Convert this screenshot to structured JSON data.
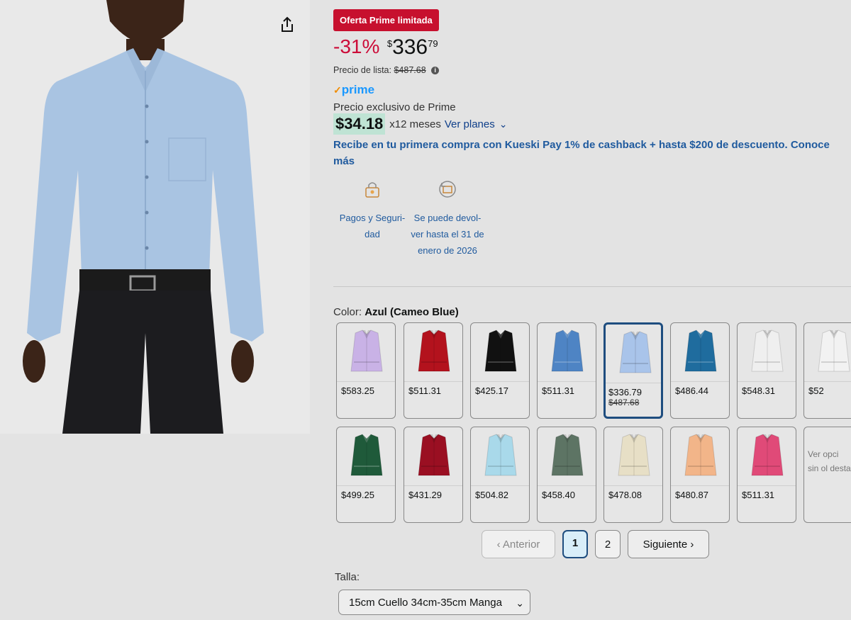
{
  "badge": "Oferta Prime limitada",
  "price": {
    "discount": "-31%",
    "currency": "$",
    "whole": "336",
    "fraction": "79",
    "list_label": "Precio de lista:",
    "list_value": "$487.68"
  },
  "prime": {
    "logo_text": "prime",
    "exclusive_label": "Precio exclusivo de Prime",
    "installment_amount": "$34.18",
    "installment_months": "x12 meses",
    "plans_link": "Ver planes"
  },
  "kueski_text": "Recibe en tu primera compra con Kueski Pay 1% de cashback + hasta $200 de descuento. Conoce más",
  "features": [
    {
      "label": "Pagos y Seguri-dad",
      "icon": "lock-icon"
    },
    {
      "label": "Se puede devol-ver hasta el 31 de enero de 2026",
      "icon": "return-icon"
    }
  ],
  "color": {
    "label": "Color:",
    "selected": "Azul (Cameo Blue)"
  },
  "swatches_row1": [
    {
      "price": "$583.25",
      "color": "#c9b2e6"
    },
    {
      "price": "$511.31",
      "color": "#b3121d"
    },
    {
      "price": "$425.17",
      "color": "#111111"
    },
    {
      "price": "$511.31",
      "color": "#4e84c4"
    },
    {
      "price": "$336.79",
      "old_price": "$487.68",
      "color": "#a9c4ea",
      "selected": true
    },
    {
      "price": "$486.44",
      "color": "#1f6c9e"
    },
    {
      "price": "$548.31",
      "color": "#efefef"
    },
    {
      "price": "$52",
      "color": "#f2f2f2"
    }
  ],
  "swatches_row2": [
    {
      "price": "$499.25",
      "color": "#1f5a3a"
    },
    {
      "price": "$431.29",
      "color": "#9a0f22"
    },
    {
      "price": "$504.82",
      "color": "#a9d9ea"
    },
    {
      "price": "$458.40",
      "color": "#5d7464"
    },
    {
      "price": "$478.08",
      "color": "#e7dfc6"
    },
    {
      "price": "$480.87",
      "color": "#f2b589"
    },
    {
      "price": "$511.31",
      "color": "#e04a78"
    }
  ],
  "more_options_text": "Ver opci sin ol desta",
  "pagination": {
    "prev": "Anterior",
    "pages": [
      "1",
      "2"
    ],
    "next": "Siguiente"
  },
  "size": {
    "label": "Talla:",
    "selected": "15cm Cuello 34cm-35cm Manga"
  }
}
